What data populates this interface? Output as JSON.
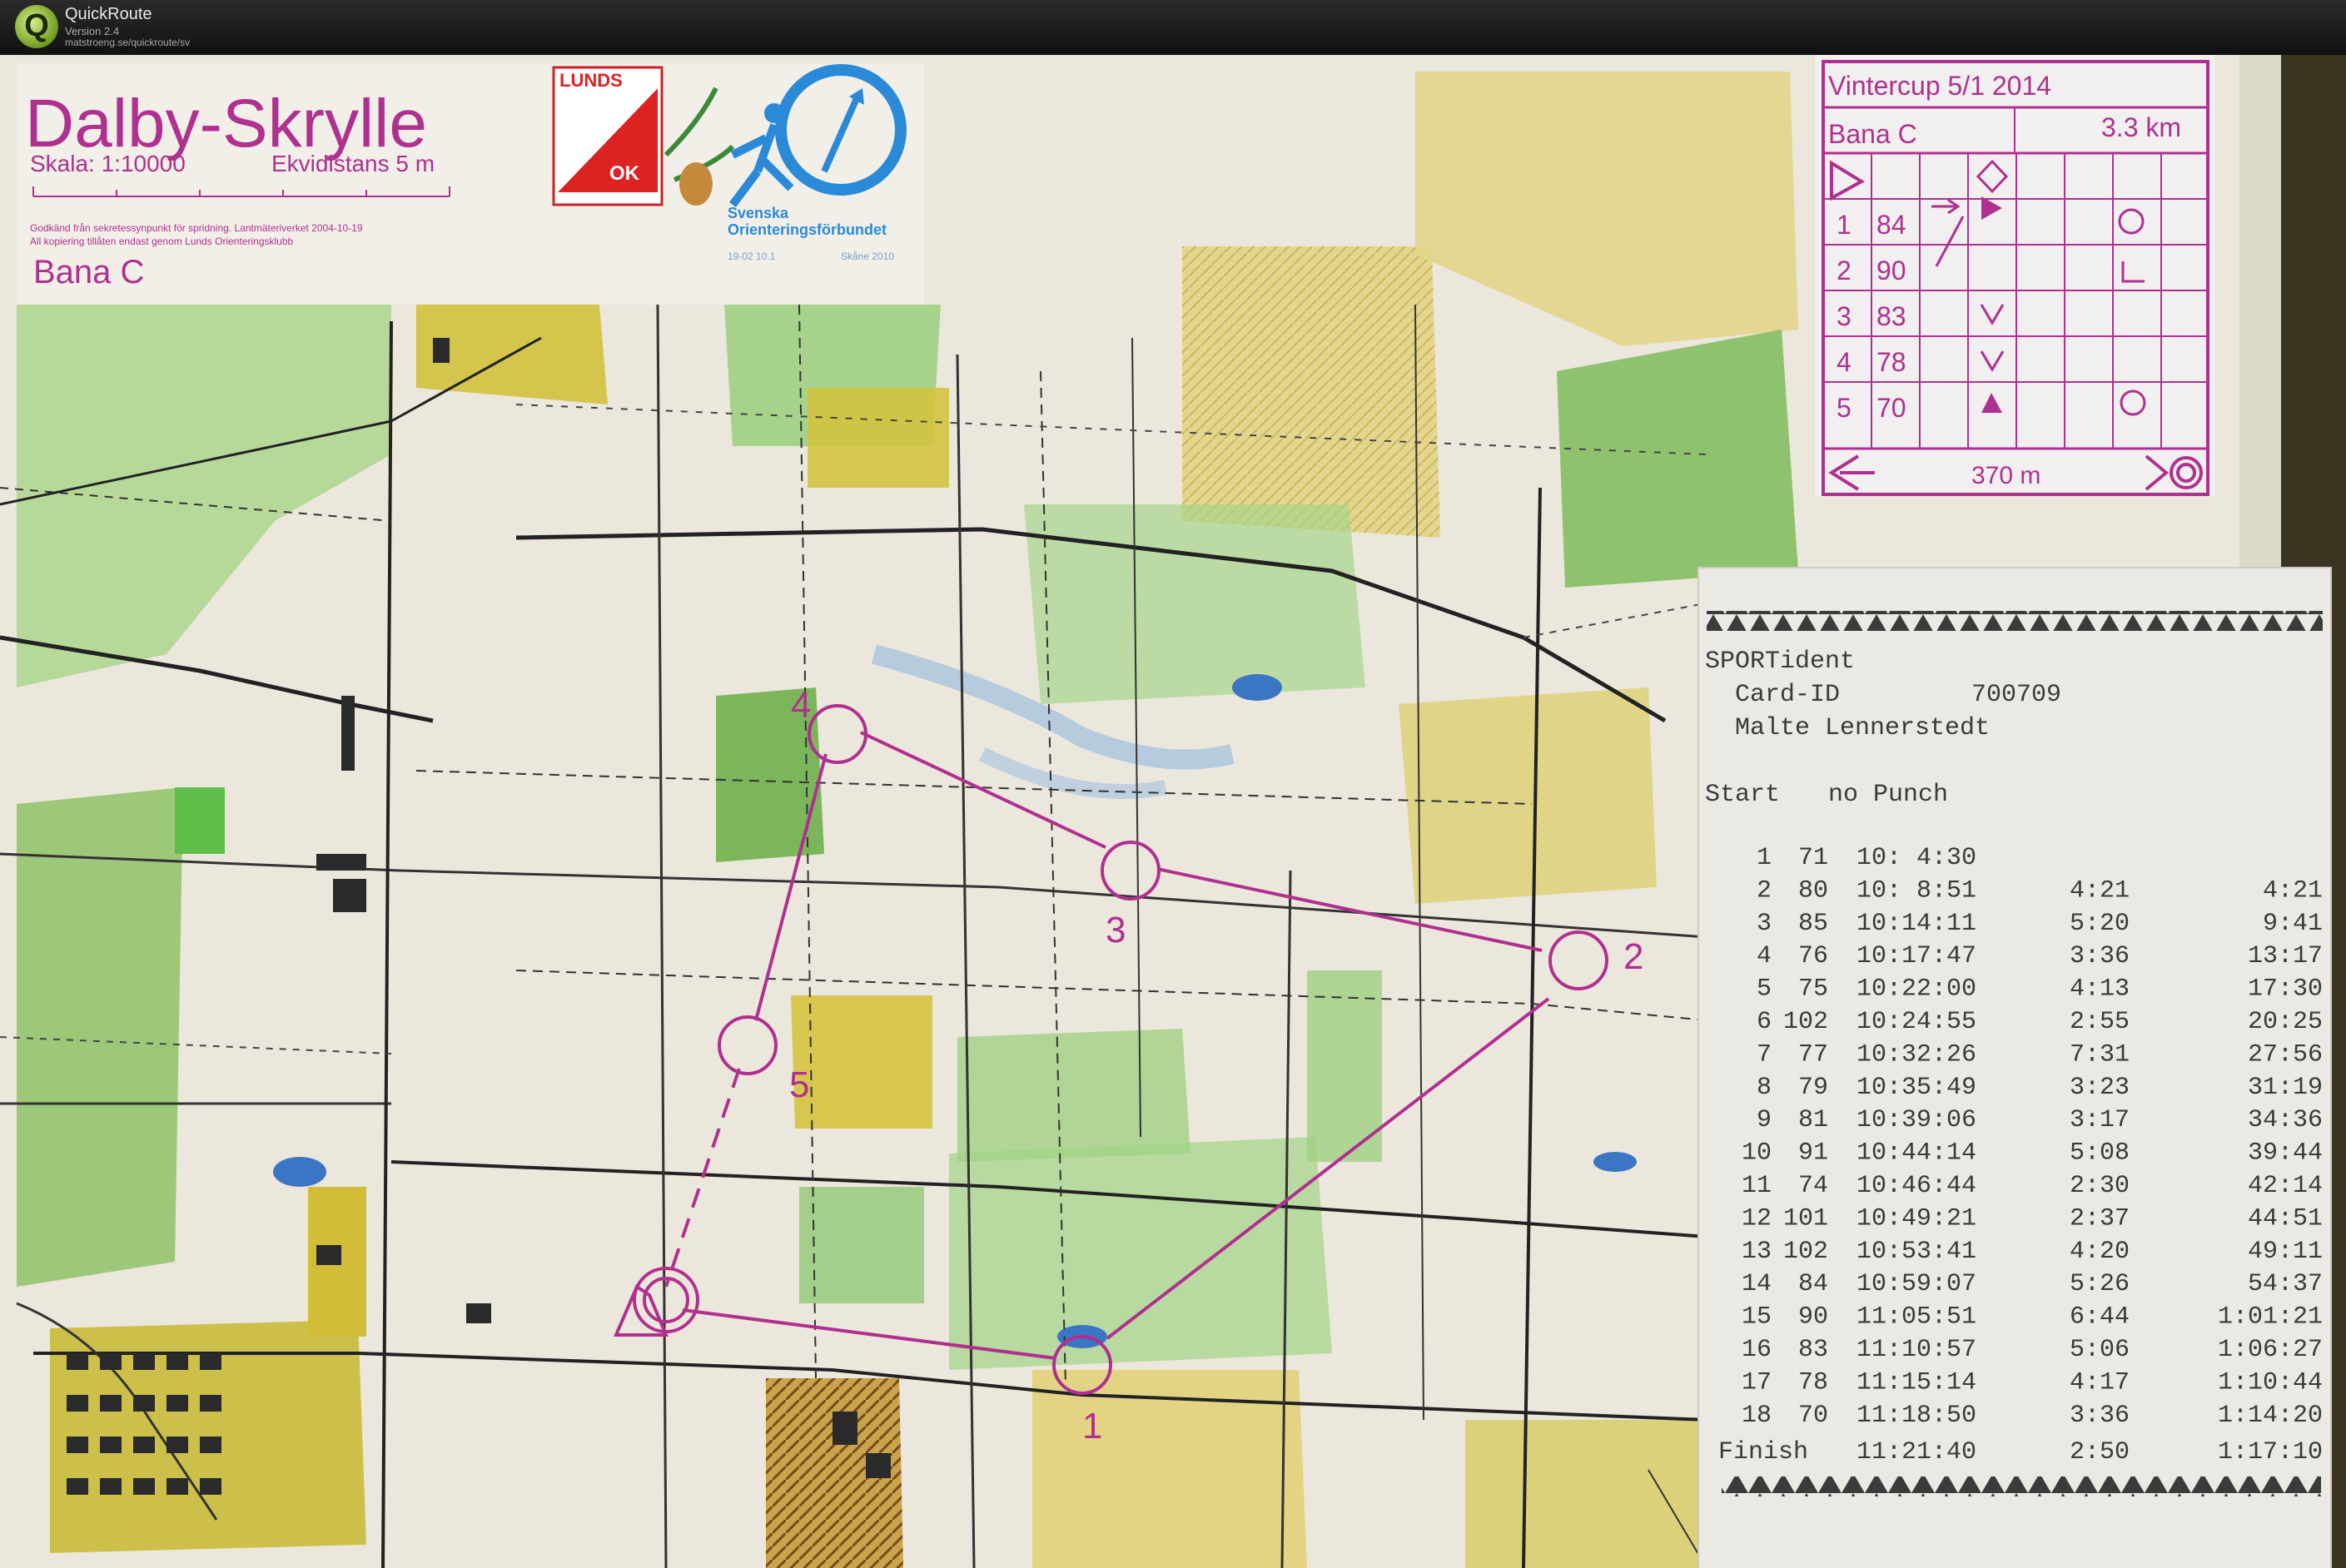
{
  "app": {
    "name": "QuickRoute",
    "version": "Version 2.4",
    "url": "matstroeng.se/quickroute/sv",
    "logo_letter": "Q"
  },
  "map_header": {
    "title": "Dalby-Skrylle",
    "scale": "Skala: 1:10000",
    "contour": "Ekvidistans 5 m",
    "approval": "Godkänd från sekretessynpunkt för spridning. Lantmäteriverket 2004-10-19",
    "copy_note": "All kopiering tillåten endast genom Lunds Orienteringsklubb",
    "course": "Bana C",
    "club_top": "LUNDS",
    "club_bottom": "OK",
    "federation_line1": "Svenska",
    "federation_line2": "Orienteringsförbundet",
    "edition_a": "19-02 10.1",
    "edition_b": "Skåne 2010"
  },
  "control_description": {
    "event": "Vintercup 5/1 2014",
    "course": "Bana C",
    "distance": "3.3 km",
    "rows": [
      {
        "num": "1",
        "code": "84"
      },
      {
        "num": "2",
        "code": "90"
      },
      {
        "num": "3",
        "code": "83"
      },
      {
        "num": "4",
        "code": "78"
      },
      {
        "num": "5",
        "code": "70"
      }
    ],
    "finish_distance": "370 m"
  },
  "course_labels": [
    "1",
    "2",
    "3",
    "4",
    "5"
  ],
  "receipt": {
    "brand": "SPORTident",
    "card_label": "Card-ID",
    "card_id": "700709",
    "runner": "Malte Lennerstedt",
    "start_label": "Start",
    "start_value": "no Punch",
    "splits": [
      {
        "n": "1",
        "code": "71",
        "time": "10: 4:30",
        "leg": "",
        "total": ""
      },
      {
        "n": "2",
        "code": "80",
        "time": "10: 8:51",
        "leg": "4:21",
        "total": "4:21"
      },
      {
        "n": "3",
        "code": "85",
        "time": "10:14:11",
        "leg": "5:20",
        "total": "9:41"
      },
      {
        "n": "4",
        "code": "76",
        "time": "10:17:47",
        "leg": "3:36",
        "total": "13:17"
      },
      {
        "n": "5",
        "code": "75",
        "time": "10:22:00",
        "leg": "4:13",
        "total": "17:30"
      },
      {
        "n": "6",
        "code": "102",
        "time": "10:24:55",
        "leg": "2:55",
        "total": "20:25"
      },
      {
        "n": "7",
        "code": "77",
        "time": "10:32:26",
        "leg": "7:31",
        "total": "27:56"
      },
      {
        "n": "8",
        "code": "79",
        "time": "10:35:49",
        "leg": "3:23",
        "total": "31:19"
      },
      {
        "n": "9",
        "code": "81",
        "time": "10:39:06",
        "leg": "3:17",
        "total": "34:36"
      },
      {
        "n": "10",
        "code": "91",
        "time": "10:44:14",
        "leg": "5:08",
        "total": "39:44"
      },
      {
        "n": "11",
        "code": "74",
        "time": "10:46:44",
        "leg": "2:30",
        "total": "42:14"
      },
      {
        "n": "12",
        "code": "101",
        "time": "10:49:21",
        "leg": "2:37",
        "total": "44:51"
      },
      {
        "n": "13",
        "code": "102",
        "time": "10:53:41",
        "leg": "4:20",
        "total": "49:11"
      },
      {
        "n": "14",
        "code": "84",
        "time": "10:59:07",
        "leg": "5:26",
        "total": "54:37"
      },
      {
        "n": "15",
        "code": "90",
        "time": "11:05:51",
        "leg": "6:44",
        "total": "1:01:21"
      },
      {
        "n": "16",
        "code": "83",
        "time": "11:10:57",
        "leg": "5:06",
        "total": "1:06:27"
      },
      {
        "n": "17",
        "code": "78",
        "time": "11:15:14",
        "leg": "4:17",
        "total": "1:10:44"
      },
      {
        "n": "18",
        "code": "70",
        "time": "11:18:50",
        "leg": "3:36",
        "total": "1:14:20"
      }
    ],
    "finish_label": "Finish",
    "finish_time": "11:21:40",
    "finish_leg": "2:50",
    "finish_total": "1:17:10"
  },
  "colors": {
    "course_purple": "#b0308f",
    "map_paper": "#ece7dc",
    "forest_green": "#7fbf5a",
    "open_yellow": "#d8c24a",
    "receipt_paper": "#ebe9e3"
  }
}
